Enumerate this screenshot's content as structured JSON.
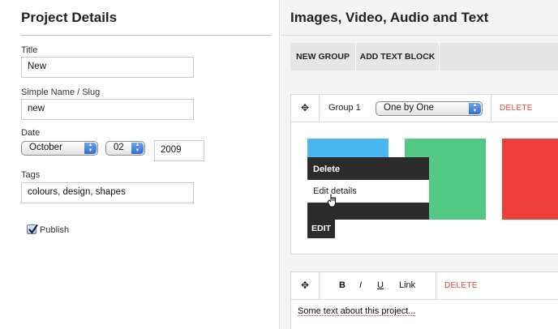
{
  "project": {
    "title": "Project Details",
    "fields": {
      "title_label": "Title",
      "title_value": "New",
      "slug_label": "Simple Name / Slug",
      "slug_value": "new",
      "date_label": "Date",
      "month": "October",
      "day": "02",
      "year": "2009",
      "tags_label": "Tags",
      "tags_value": "colours, design, shapes"
    },
    "publish_label": "Publish",
    "publish_checked": true
  },
  "media": {
    "title": "Images, Video, Audio and Text",
    "toolbar": {
      "new_group": "NEW GROUP",
      "add_text_block": "ADD TEXT BLOCK"
    },
    "group": {
      "move_glyph": "✥",
      "name": "Group 1",
      "layout": "One by One",
      "delete": "DELETE",
      "tiles": [
        {
          "color": "#4ab6f2"
        },
        {
          "color": "#54c985"
        },
        {
          "color": "#ee3e3b"
        }
      ],
      "context_menu": {
        "delete": "Delete",
        "edit_details": "Edit details",
        "edit": "EDIT"
      }
    },
    "text_block": {
      "move_glyph": "✥",
      "bold": "B",
      "italic": "I",
      "underline": "U",
      "link": "Link",
      "delete": "DELETE",
      "content": "Some text about this project..."
    }
  }
}
